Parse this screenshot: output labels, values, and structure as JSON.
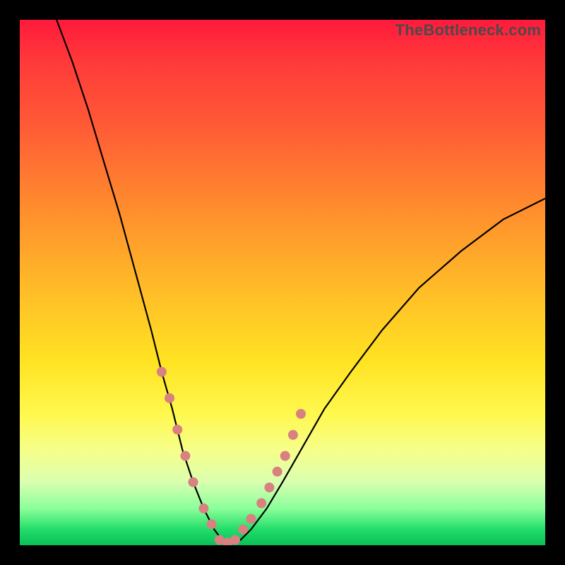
{
  "watermark": "TheBottleneck.com",
  "colors": {
    "frame": "#000000",
    "curve_stroke": "#000000",
    "marker_fill": "#d98080",
    "gradient_stops": [
      "#ff1a3c",
      "#ff5a36",
      "#ffb828",
      "#fff84e",
      "#d9ffb0",
      "#22dd6a",
      "#0bbf58"
    ]
  },
  "chart_data": {
    "type": "line",
    "title": "",
    "xlabel": "",
    "ylabel": "",
    "xlim": [
      0,
      100
    ],
    "ylim": [
      0,
      100
    ],
    "series": [
      {
        "name": "bottleneck-curve",
        "x": [
          7,
          10,
          13,
          16,
          19,
          22,
          25,
          27,
          29,
          31,
          33,
          35,
          37,
          38.5,
          40,
          42,
          44,
          47,
          50,
          54,
          58,
          63,
          69,
          76,
          84,
          92,
          100
        ],
        "y": [
          100,
          92,
          83,
          73,
          63,
          52,
          41,
          33,
          26,
          18,
          12,
          7,
          3,
          1,
          0.5,
          1,
          3,
          7,
          12,
          19,
          26,
          33,
          41,
          49,
          56,
          62,
          66
        ]
      }
    ],
    "markers": {
      "name": "highlighted-points",
      "color": "#d98080",
      "x": [
        27,
        28.5,
        30,
        31.5,
        33,
        35,
        36.5,
        38,
        39.5,
        41,
        42.5,
        44,
        46,
        47.5,
        49,
        50.5,
        52,
        53.5
      ],
      "y": [
        33,
        28,
        22,
        17,
        12,
        7,
        4,
        1,
        0.5,
        1,
        3,
        5,
        8,
        11,
        14,
        17,
        21,
        25
      ]
    }
  }
}
